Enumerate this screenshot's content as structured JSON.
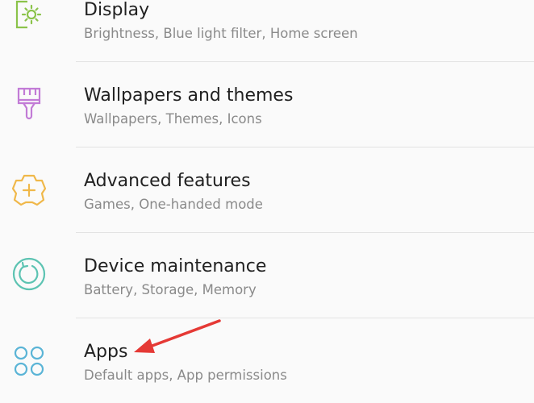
{
  "settings": {
    "items": [
      {
        "title": "Display",
        "subtitle": "Brightness, Blue light filter, Home screen",
        "icon": "display-icon",
        "icon_color": "#8bc34a"
      },
      {
        "title": "Wallpapers and themes",
        "subtitle": "Wallpapers, Themes, Icons",
        "icon": "paintbrush-icon",
        "icon_color": "#c27bd6"
      },
      {
        "title": "Advanced features",
        "subtitle": "Games, One-handed mode",
        "icon": "gear-plus-icon",
        "icon_color": "#f0b84a"
      },
      {
        "title": "Device maintenance",
        "subtitle": "Battery, Storage, Memory",
        "icon": "refresh-circle-icon",
        "icon_color": "#5cc3b2"
      },
      {
        "title": "Apps",
        "subtitle": "Default apps, App permissions",
        "icon": "apps-grid-icon",
        "icon_color": "#5ab4d6"
      }
    ]
  },
  "annotation": {
    "arrow_color": "#e53935"
  }
}
